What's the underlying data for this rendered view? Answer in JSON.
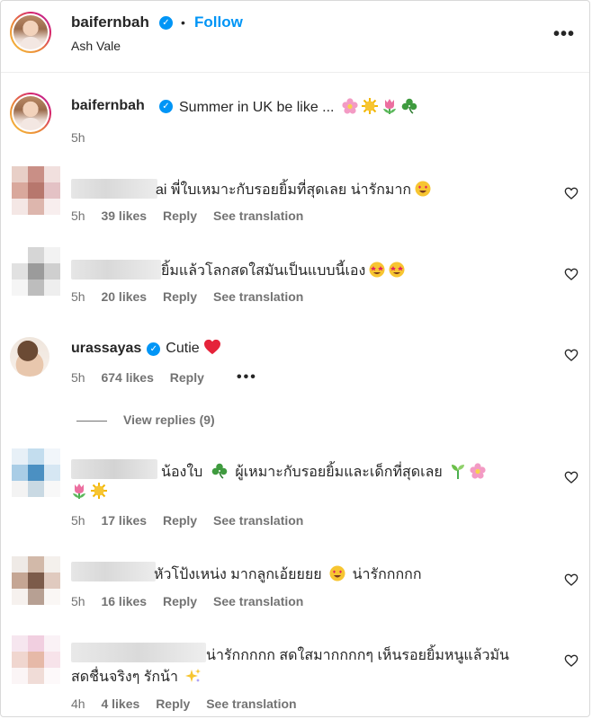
{
  "post_header": {
    "username": "baifernbah",
    "separator": "•",
    "follow_label": "Follow",
    "location": "Ash Vale",
    "more_icon": "more-options-icon"
  },
  "caption": {
    "username": "baifernbah",
    "text": "Summer in UK be like ...",
    "time": "5h"
  },
  "comments": [
    {
      "text": "ai พี่ใบเหมาะกับรอยยิ้มที่สุดเลย น่ารักมาก",
      "time": "5h",
      "likes": "39 likes",
      "reply": "Reply",
      "translation": "See translation"
    },
    {
      "text": "ยิ้มแล้วโลกสดใสมันเป็นแบบนี้เอง",
      "time": "5h",
      "likes": "20 likes",
      "reply": "Reply",
      "translation": "See translation"
    },
    {
      "username": "urassayas",
      "text": "Cutie",
      "time": "5h",
      "likes": "674 likes",
      "reply": "Reply",
      "more": "•••",
      "view_replies": "View replies (9)"
    },
    {
      "username_fragment": "yingphet99",
      "text_line1": "น้องใบ",
      "text_line1b": "ผู้เหมาะกับรอยยิ้มและเด็กที่สุดเลย",
      "time": "5h",
      "likes": "17 likes",
      "reply": "Reply",
      "translation": "See translation"
    },
    {
      "text": "หัวโป้งเหน่ง มากลูกเอ้ยยยย",
      "text_after": "น่ารักกกกก",
      "time": "5h",
      "likes": "16 likes",
      "reply": "Reply",
      "translation": "See translation"
    },
    {
      "username_fragment": "kkubonchonchilps",
      "text_line1": "น่ารักกกกก สดใสมากกกกๆ เห็นรอยยิ้มหนูแล้วมัน",
      "text_line2": "สดชื่นจริงๆ รักน้า",
      "time": "4h",
      "likes": "4 likes",
      "reply": "Reply",
      "translation": "See translation"
    }
  ],
  "colors": {
    "accent": "#0095f6",
    "text": "#262626",
    "secondary": "#737373",
    "heart_red": "#ed4956"
  }
}
